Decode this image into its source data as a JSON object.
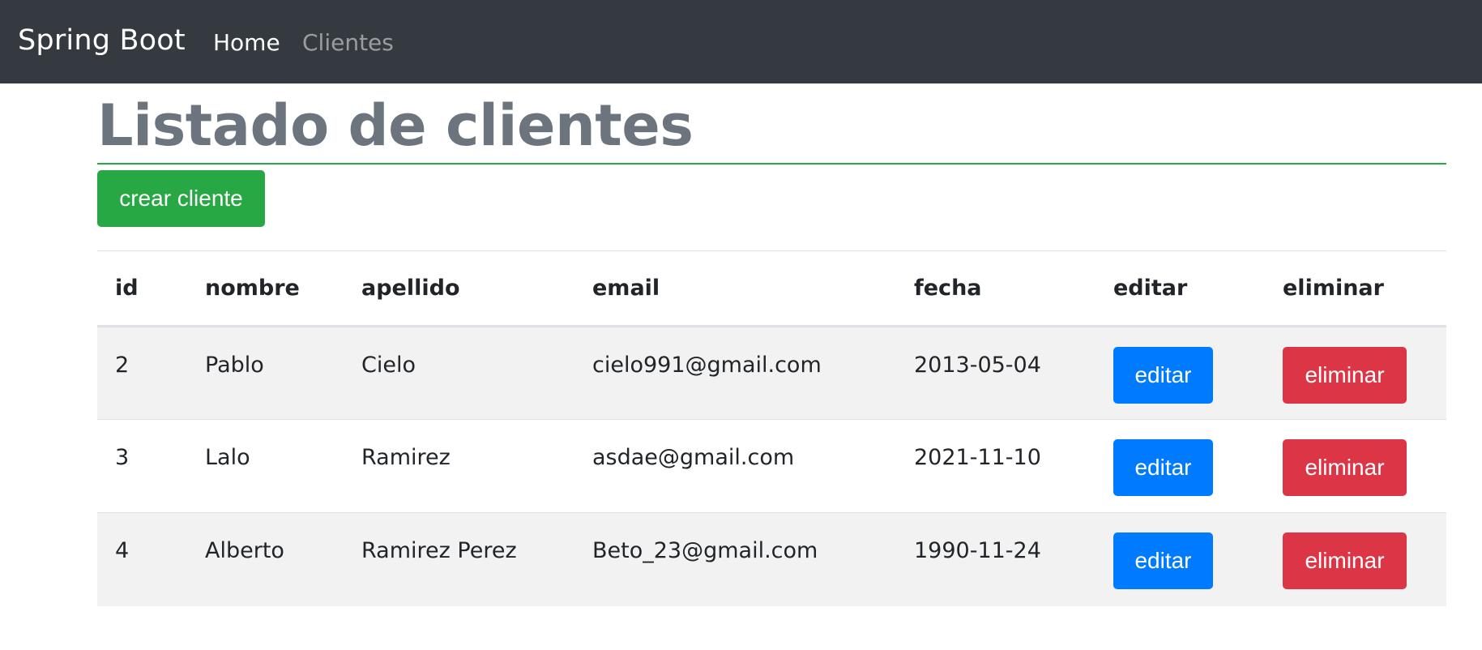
{
  "navbar": {
    "brand": "Spring Boot",
    "links": [
      {
        "label": "Home"
      },
      {
        "label": "Clientes"
      }
    ]
  },
  "page": {
    "title": "Listado de clientes",
    "create_button": "crear cliente"
  },
  "table": {
    "headers": [
      "id",
      "nombre",
      "apellido",
      "email",
      "fecha",
      "editar",
      "eliminar"
    ],
    "rows": [
      {
        "id": "2",
        "nombre": "Pablo",
        "apellido": "Cielo",
        "email": "cielo991@gmail.com",
        "fecha": "2013-05-04",
        "edit_label": "editar",
        "delete_label": "eliminar"
      },
      {
        "id": "3",
        "nombre": "Lalo",
        "apellido": "Ramirez",
        "email": "asdae@gmail.com",
        "fecha": "2021-11-10",
        "edit_label": "editar",
        "delete_label": "eliminar"
      },
      {
        "id": "4",
        "nombre": "Alberto",
        "apellido": "Ramirez Perez",
        "email": "Beto_23@gmail.com",
        "fecha": "1990-11-24",
        "edit_label": "editar",
        "delete_label": "eliminar"
      }
    ]
  },
  "colors": {
    "navbar_bg": "#343a40",
    "success": "#28a745",
    "primary": "#007bff",
    "danger": "#dc3545",
    "title": "#6c757d"
  }
}
